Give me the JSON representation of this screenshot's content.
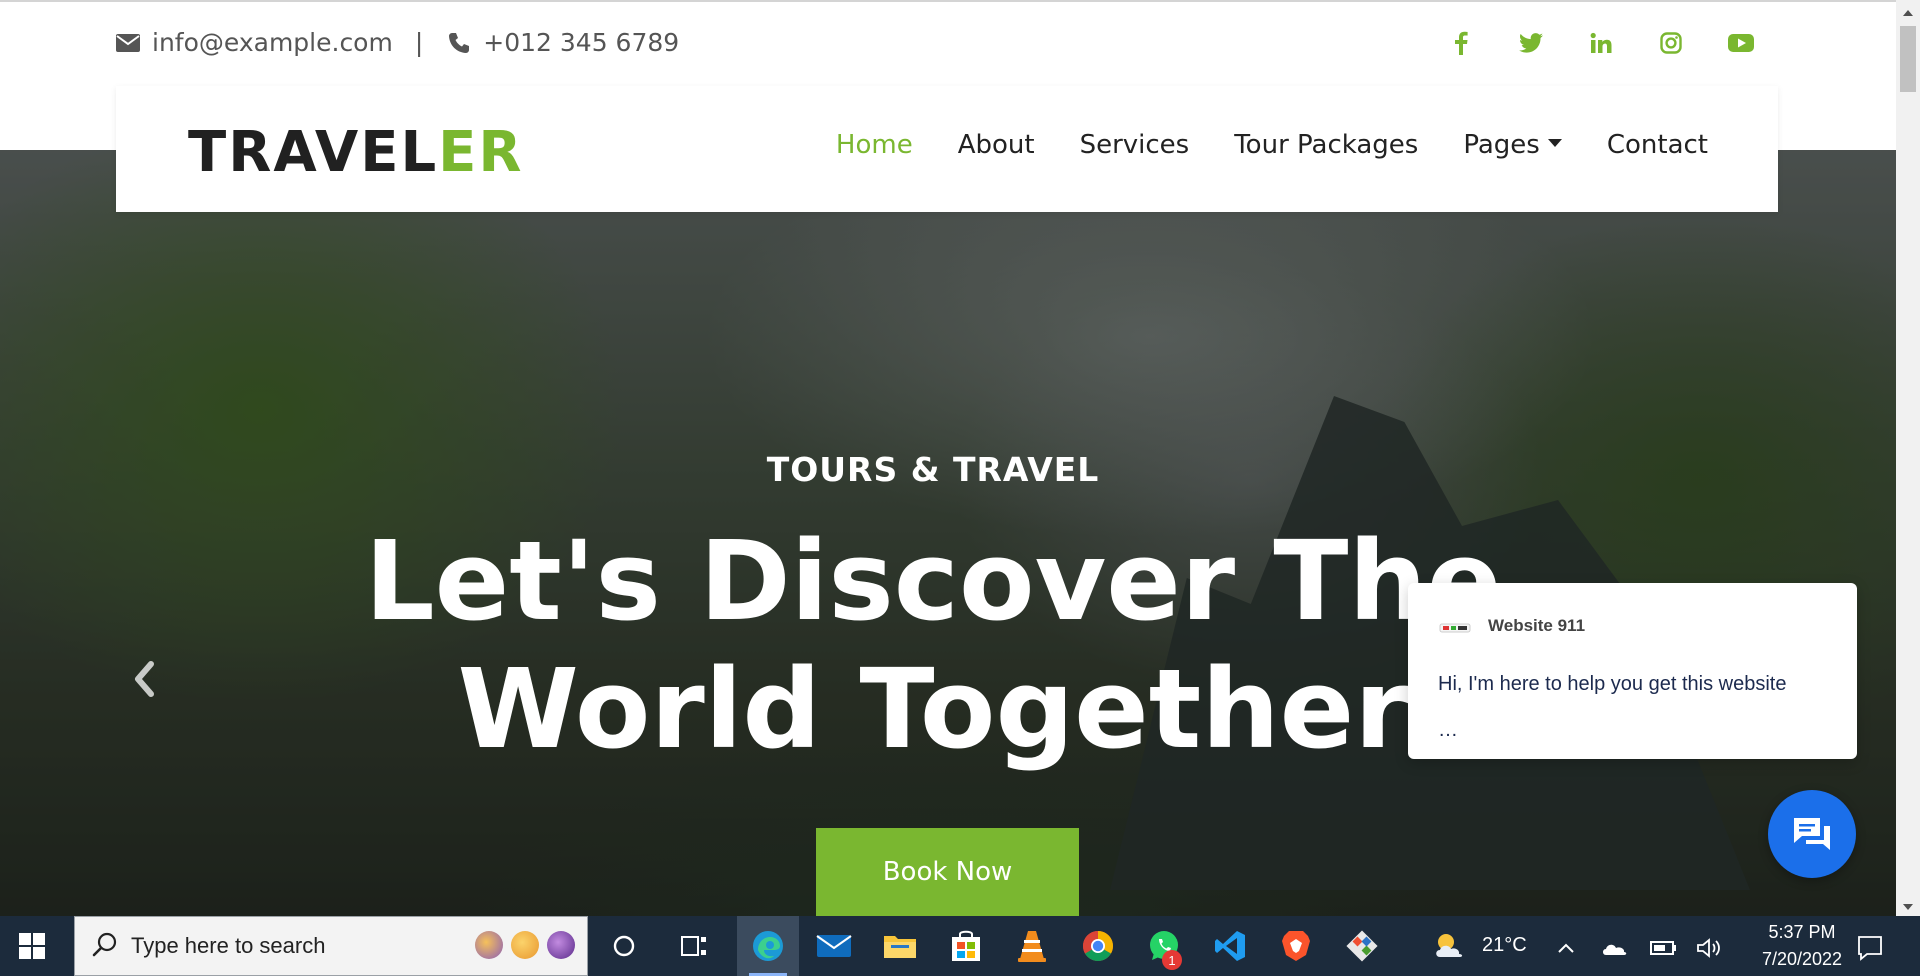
{
  "topbar": {
    "email": "info@example.com",
    "separator": "|",
    "phone": "+012 345 6789",
    "social": [
      "facebook-icon",
      "twitter-icon",
      "linkedin-icon",
      "instagram-icon",
      "youtube-icon"
    ]
  },
  "navbar": {
    "logo_main": "TRAVEL",
    "logo_accent": "ER",
    "menu": [
      "Home",
      "About",
      "Services",
      "Tour Packages",
      "Pages",
      "Contact"
    ],
    "active": "Home"
  },
  "hero": {
    "kicker": "TOURS & TRAVEL",
    "headline_line1": "Let's Discover The",
    "headline_line2": "World Together",
    "cta": "Book Now"
  },
  "chat": {
    "name": "Website 911",
    "message": "Hi, I'm here to help you get this website",
    "ellipsis": "…"
  },
  "taskbar": {
    "search_placeholder": "Type here to search",
    "temperature": "21°C",
    "time": "5:37 PM",
    "date": "7/20/2022",
    "whatsapp_badge": "1",
    "apps": [
      "cortana-icon",
      "task-view-icon",
      "edge-icon",
      "mail-icon",
      "file-explorer-icon",
      "store-icon",
      "vlc-icon",
      "chrome-icon",
      "whatsapp-icon",
      "vscode-icon",
      "brave-icon",
      "git-icon"
    ]
  },
  "colors": {
    "accent": "#7ab730",
    "chat_button": "#1b6fea",
    "taskbar": "#1c2b3c"
  }
}
